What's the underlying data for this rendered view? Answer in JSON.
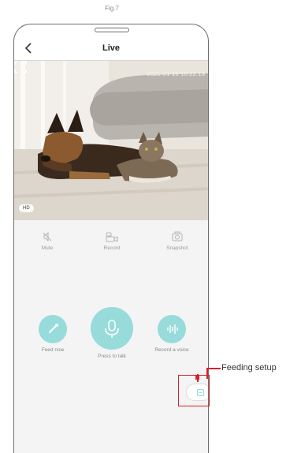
{
  "figure": {
    "caption": "Fig.7"
  },
  "header": {
    "title": "Live"
  },
  "video": {
    "timestamp": "2021-01-16 10:22:13",
    "quality_badge": "HD"
  },
  "top_controls": [
    {
      "label": "Mute",
      "icon": "mute-icon"
    },
    {
      "label": "Record",
      "icon": "record-icon"
    },
    {
      "label": "Snapshot",
      "icon": "camera-icon"
    }
  ],
  "main_controls": {
    "feed": {
      "label": "Feed now",
      "icon": "feed-icon"
    },
    "talk": {
      "label": "Press to talk",
      "icon": "microphone-icon"
    },
    "voice": {
      "label": "Record a voice",
      "icon": "voice-wave-icon"
    }
  },
  "annotation": {
    "label": "Feeding setup"
  },
  "colors": {
    "accent": "#97dbdb",
    "annotation": "#d9202a",
    "panel": "#f4f4f4"
  }
}
